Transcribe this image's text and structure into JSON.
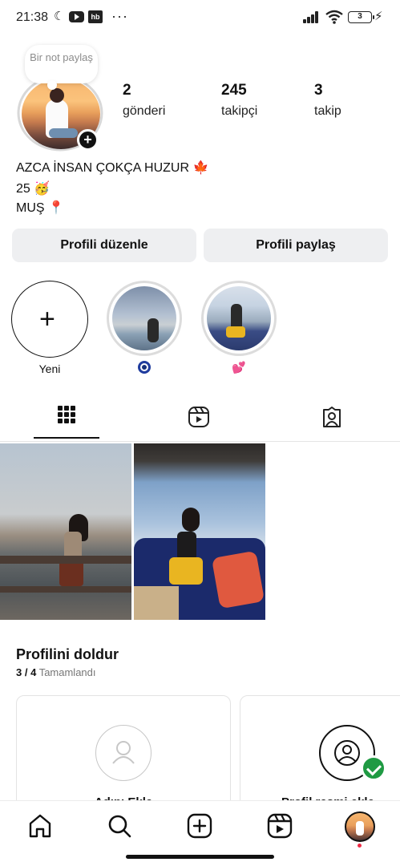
{
  "status_bar": {
    "time": "21:38",
    "moon_glyph": "☾",
    "app_badge": "hb",
    "more": "···",
    "battery": "3",
    "bolt": "⚡",
    "icons": [
      "moon-icon",
      "youtube-icon",
      "hb-app-icon",
      "signal-icon",
      "wifi-icon",
      "battery-icon",
      "charging-icon"
    ]
  },
  "profile": {
    "note_text": "Bir not paylaş",
    "stats": [
      {
        "value": "2",
        "label": "gönderi"
      },
      {
        "value": "245",
        "label": "takipçi"
      },
      {
        "value": "3",
        "label": "takip"
      }
    ],
    "bio": {
      "name_line": "AZCA İNSAN ÇOKÇA HUZUR 🍁",
      "age_line": "25 🥳",
      "location_line": "MUŞ 📍"
    },
    "buttons": {
      "edit": "Profili düzenle",
      "share": "Profili paylaş"
    }
  },
  "highlights": [
    {
      "label": "Yeni",
      "icon": "plus-icon"
    },
    {
      "label": "🧿",
      "icon": "evil-eye-icon"
    },
    {
      "label": "💕",
      "icon": "hearts-icon"
    }
  ],
  "tabs": [
    {
      "name": "grid",
      "icon": "grid-icon",
      "active": true
    },
    {
      "name": "reels",
      "icon": "reels-icon",
      "active": false
    },
    {
      "name": "tagged",
      "icon": "tagged-user-icon",
      "active": false
    }
  ],
  "completion": {
    "title": "Profilini doldur",
    "progress": "3 / 4",
    "progress_label": "Tamamlandı",
    "cards": [
      {
        "title": "Adını Ekle",
        "icon": "person-icon",
        "done": false
      },
      {
        "title": "Profil resmi ekle",
        "icon": "profile-picture-icon",
        "done": true
      }
    ]
  },
  "bottom_nav": {
    "items": [
      "home-icon",
      "search-icon",
      "create-icon",
      "reels-icon",
      "profile-avatar"
    ]
  },
  "colors": {
    "button_bg": "#eeeff1",
    "check_green": "#1f9a43",
    "notification_dot": "#ee2a45"
  }
}
